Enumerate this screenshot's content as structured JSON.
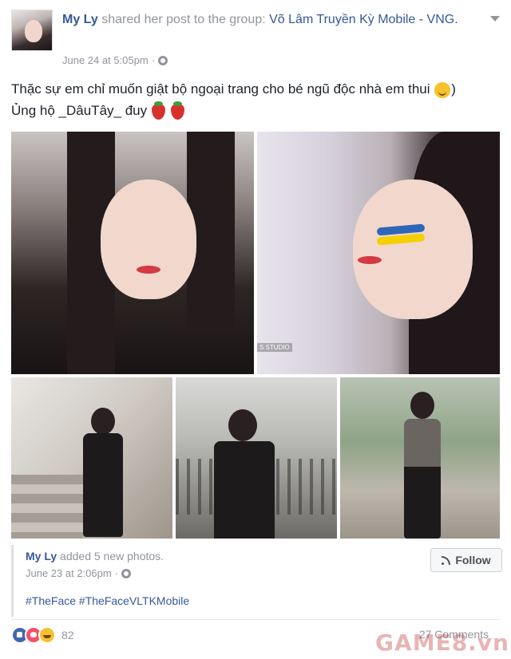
{
  "post": {
    "author": "My Ly",
    "action_text": "shared her post to the group:",
    "group_name": "Võ Lâm Truyền Kỳ Mobile - VNG.",
    "timestamp": "June 24 at 5:05pm",
    "separator": "·",
    "privacy_icon": "globe-icon",
    "status_line1": "Thặc sự em chỉ muốn giật bộ ngoại trang cho bé ngũ độc nhà em thui",
    "status_line1_end": ")",
    "status_line2": "Ủng hộ _DâuTây_ đuy"
  },
  "photos": {
    "count": 5,
    "studio_tag": "S STUDIO"
  },
  "shared": {
    "author": "My Ly",
    "action_text": "added 5 new photos.",
    "timestamp": "June 23 at 2:06pm",
    "separator": "·",
    "follow_label": "Follow",
    "hashtags": "#TheFace #TheFaceVLTKMobile"
  },
  "footer": {
    "reaction_count": "82",
    "comments": "27 Comments",
    "reactions": [
      "like-icon",
      "love-icon",
      "haha-icon"
    ],
    "watermark": "GAME8.vn"
  },
  "colors": {
    "link": "#365899",
    "muted": "#90949c",
    "like": "#4267b2",
    "love": "#f25268",
    "haha": "#f7c12e"
  }
}
